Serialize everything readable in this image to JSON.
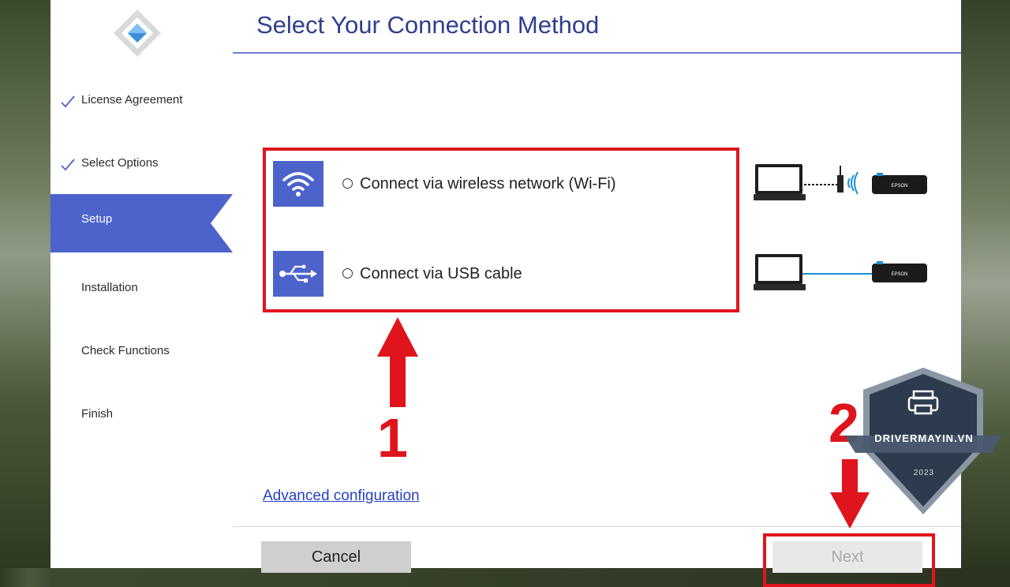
{
  "sidebar": {
    "steps": [
      {
        "label": "License Agreement",
        "done": true
      },
      {
        "label": "Select Options",
        "done": true
      },
      {
        "label": "Setup",
        "active": true
      },
      {
        "label": "Installation"
      },
      {
        "label": "Check Functions"
      },
      {
        "label": "Finish"
      }
    ]
  },
  "main": {
    "title": "Select Your Connection Method",
    "options": [
      {
        "label": "Connect via wireless network (Wi-Fi)",
        "icon": "wifi-icon",
        "selected": false
      },
      {
        "label": "Connect via USB cable",
        "icon": "usb-icon",
        "selected": false
      }
    ],
    "printer_brand": "EPSON",
    "advanced_link": "Advanced configuration"
  },
  "footer": {
    "cancel_label": "Cancel",
    "next_label": "Next"
  },
  "annotations": {
    "step1": "1",
    "step2": "2",
    "badge_text": "DRIVERMAYIN.VN",
    "badge_year": "2023"
  },
  "colors": {
    "accent": "#4d63cc",
    "title": "#2f3f8e",
    "highlight": "#e0141c",
    "link": "#2440c8"
  }
}
